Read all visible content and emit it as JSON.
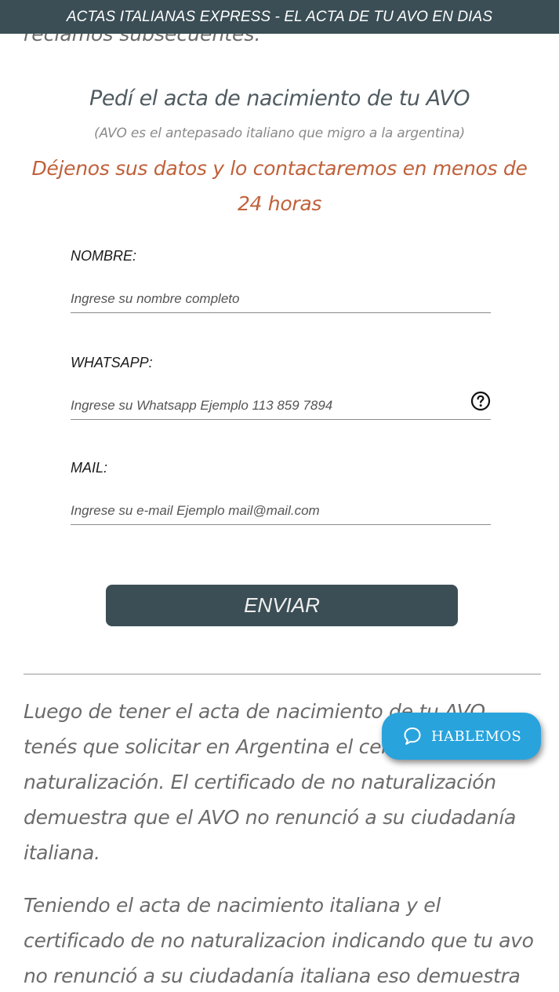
{
  "topbar": {
    "text": "ACTAS ITALIANAS EXPRESS - EL ACTA DE TU AVO EN DIAS"
  },
  "intro": {
    "partial_text": "reclamos subsecuentes."
  },
  "form_section": {
    "title": "Pedí el acta de nacimiento de tu AVO",
    "subtitle": "(AVO es el antepasado italiano que migro a la argentina)",
    "callout": "Déjenos sus datos y lo contactaremos en menos de 24 horas",
    "callout_color": "#c0603a",
    "fields": {
      "name": {
        "label": "NOMBRE:",
        "placeholder": "Ingrese su nombre completo",
        "value": ""
      },
      "whatsapp": {
        "label": "WHATSAPP:",
        "placeholder": "Ingrese su Whatsapp Ejemplo 113 859 7894",
        "value": ""
      },
      "mail": {
        "label": "MAIL:",
        "placeholder": "Ingrese su e-mail Ejemplo mail@mail.com",
        "value": ""
      }
    },
    "help_icon": "question-circle-icon",
    "submit_label": "ENVIAR"
  },
  "body": {
    "paragraph1": "Luego de tener el acta de nacimiento de tu AVO tenés que solicitar en Argentina el certificado de no naturalización. El certificado de no naturalización demuestra que el AVO no renunció a su ciudadanía italiana.",
    "paragraph2": "Teniendo el acta de nacimiento italiana y el certificado de no naturalizacion indicando que tu avo no renunció a su ciudadanía italiana eso demuestra"
  },
  "chat_widget": {
    "label": "HABLEMOS",
    "icon": "chat-bubble-icon",
    "color": "#29a3dc"
  },
  "colors": {
    "primary_dark": "#3b4e55",
    "text_gray": "#6b6b6b"
  }
}
